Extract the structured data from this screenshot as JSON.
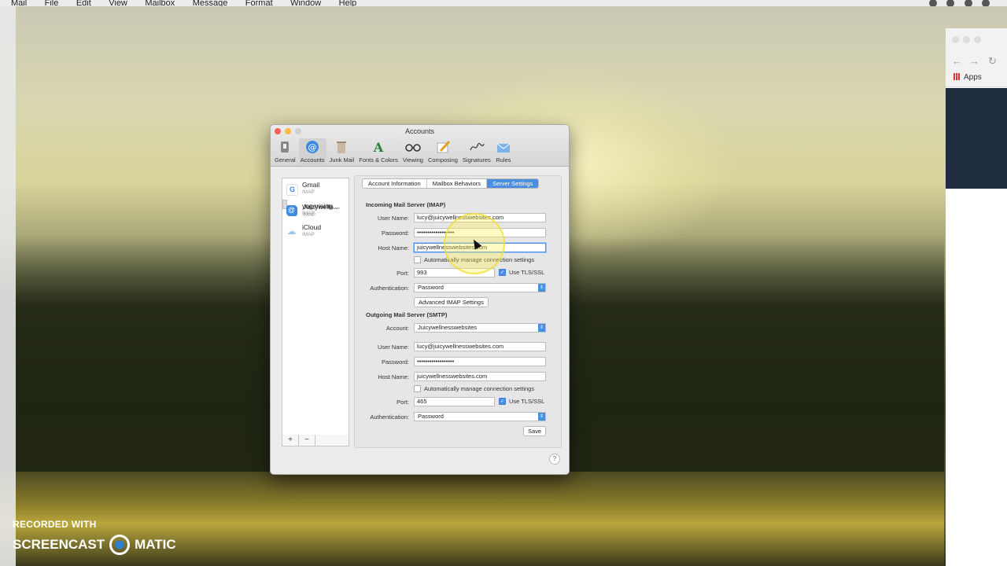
{
  "menubar": {
    "items": [
      "Mail",
      "File",
      "Edit",
      "View",
      "Mailbox",
      "Message",
      "Format",
      "Window",
      "Help"
    ]
  },
  "browser": {
    "apps_label": "Apps"
  },
  "watermark": {
    "line1": "RECORDED WITH",
    "left_word": "SCREENCAST",
    "right_word": "MATIC"
  },
  "window": {
    "title": "Accounts",
    "toolbar": [
      {
        "label": "General",
        "icon": "switch-icon"
      },
      {
        "label": "Accounts",
        "icon": "at-icon"
      },
      {
        "label": "Junk Mail",
        "icon": "trash-icon"
      },
      {
        "label": "Fonts & Colors",
        "icon": "fonts-icon"
      },
      {
        "label": "Viewing",
        "icon": "glasses-icon"
      },
      {
        "label": "Composing",
        "icon": "pencil-icon"
      },
      {
        "label": "Signatures",
        "icon": "signature-icon"
      },
      {
        "label": "Rules",
        "icon": "envelope-icon"
      }
    ],
    "accounts": [
      {
        "name": "Gmail",
        "type": "IMAP"
      },
      {
        "name": "Juicywelln...",
        "type": "IMAP"
      },
      {
        "name": "yogarising....",
        "type": "IMAP"
      },
      {
        "name": "iCloud",
        "type": "IMAP"
      }
    ],
    "list_buttons": {
      "add": "+",
      "remove": "−"
    },
    "tabs": [
      "Account Information",
      "Mailbox Behaviors",
      "Server Settings"
    ],
    "incoming": {
      "heading": "Incoming Mail Server (IMAP)",
      "user_name_label": "User Name:",
      "user_name": "lucy@juicywellnesswebsites.com",
      "password_label": "Password:",
      "password": "••••••••••••••••••",
      "host_label": "Host Name:",
      "host": "juicywellnesswebsites.com",
      "auto_manage": "Automatically manage connection settings",
      "port_label": "Port:",
      "port": "993",
      "tls": "Use TLS/SSL",
      "auth_label": "Authentication:",
      "auth": "Password",
      "advanced": "Advanced IMAP Settings"
    },
    "outgoing": {
      "heading": "Outgoing Mail Server (SMTP)",
      "account_label": "Account:",
      "account": "Juicywellnesswebsites",
      "user_name_label": "User Name:",
      "user_name": "lucy@juicywellnesswebsites.com",
      "password_label": "Password:",
      "password": "••••••••••••••••••",
      "host_label": "Host Name:",
      "host": "juicywellnesswebsites.com",
      "auto_manage": "Automatically manage connection settings",
      "port_label": "Port:",
      "port": "465",
      "tls": "Use TLS/SSL",
      "auth_label": "Authentication:",
      "auth": "Password"
    },
    "save": "Save",
    "help": "?"
  },
  "colors": {
    "accent": "#4a90e2",
    "close": "#fc5f57",
    "minimize": "#fdbc40",
    "zoom": "#34c84a"
  }
}
